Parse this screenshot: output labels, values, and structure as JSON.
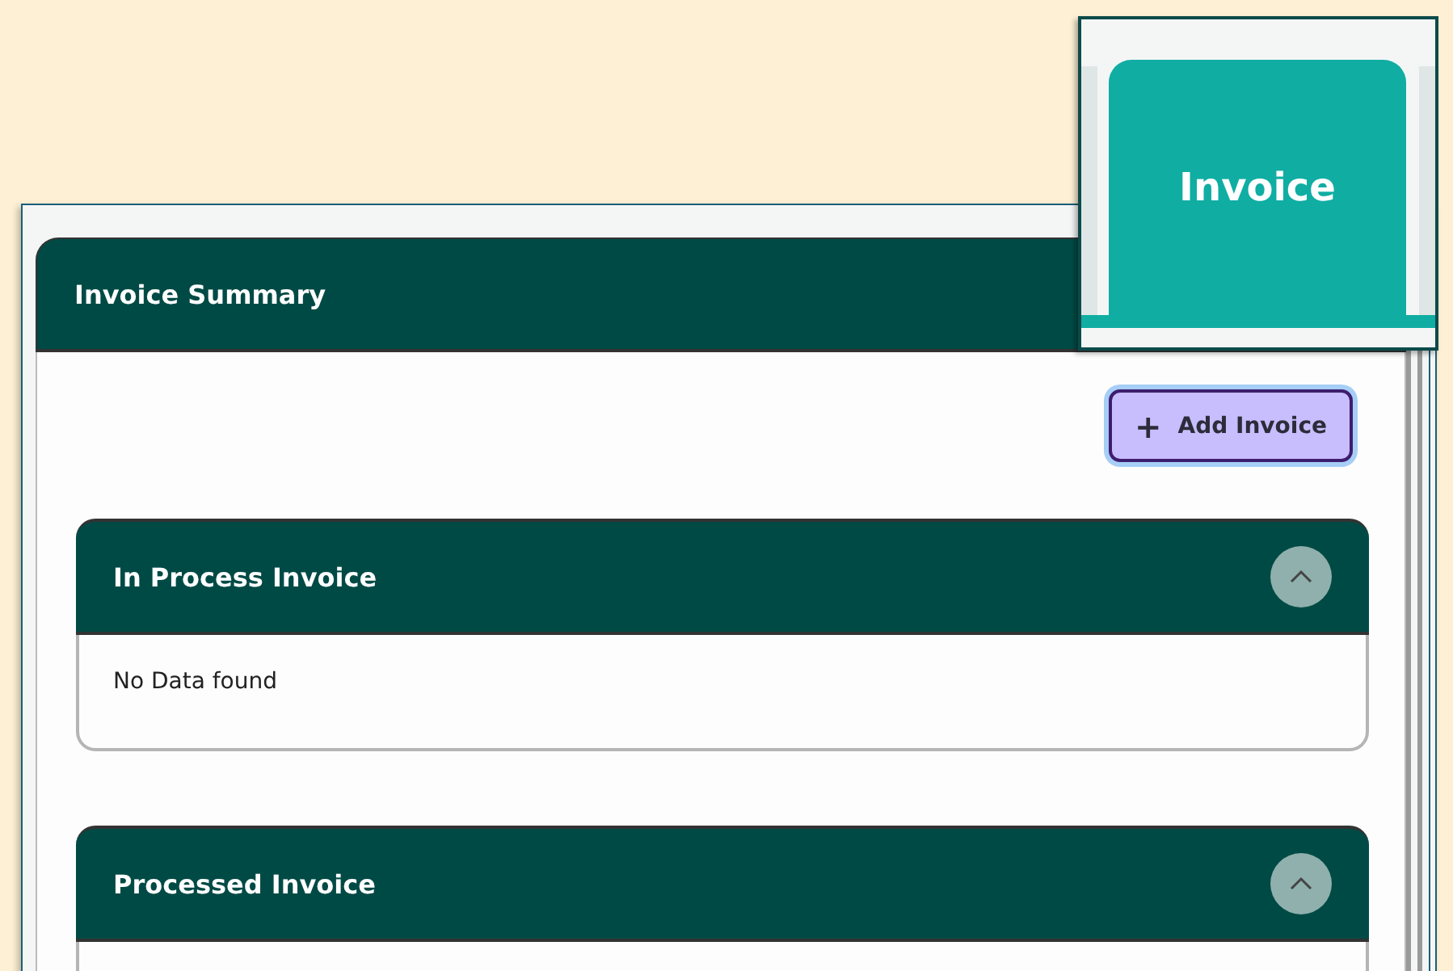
{
  "callout": {
    "tab_label": "Invoice"
  },
  "card": {
    "title": "Invoice Summary"
  },
  "add_button": {
    "icon": "+",
    "label": "Add Invoice"
  },
  "sections": [
    {
      "title": "In Process Invoice",
      "expanded": true,
      "message": "No Data found"
    },
    {
      "title": "Processed Invoice",
      "expanded": true
    }
  ]
}
